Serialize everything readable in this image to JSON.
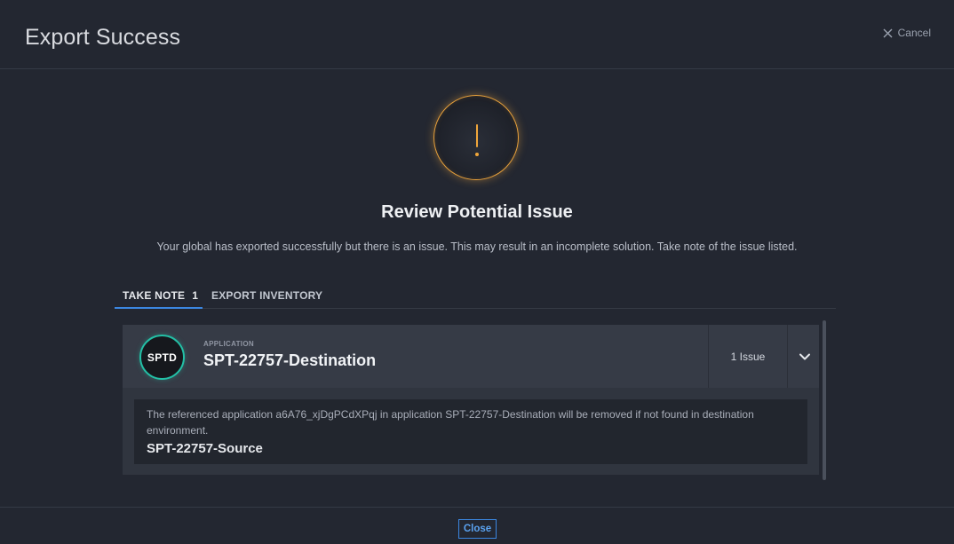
{
  "header": {
    "title": "Export Success",
    "cancel_label": "Cancel"
  },
  "status": {
    "icon": "warning-exclamation-icon",
    "accent": "#e8a13b",
    "heading": "Review Potential Issue",
    "message": "Your global has exported successfully but there is an issue. This may result in an incomplete solution. Take note of the issue listed."
  },
  "tabs": [
    {
      "label": "TAKE NOTE",
      "count": "1",
      "active": true
    },
    {
      "label": "EXPORT INVENTORY",
      "active": false
    }
  ],
  "issue_card": {
    "avatar_text": "SPTD",
    "type_label": "APPLICATION",
    "name": "SPT-22757-Destination",
    "issue_count_label": "1 Issue",
    "detail_text": "The referenced application a6A76_xjDgPCdXPqj in application SPT-22757-Destination will be removed if not found in destination environment.",
    "detail_source": "SPT-22757-Source"
  },
  "footer": {
    "close_label": "Close"
  },
  "colors": {
    "primary": "#3b86e0",
    "avatar_ring": "#23c0a6",
    "background": "#232731"
  }
}
